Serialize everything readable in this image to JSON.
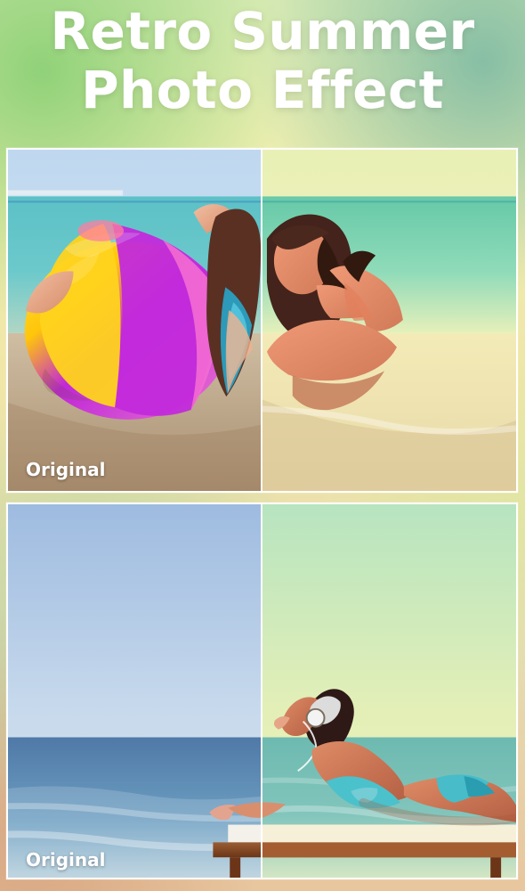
{
  "title": {
    "line1": "Retro Summer",
    "line2": "Photo Effect"
  },
  "top_panel": {
    "label": "Original"
  },
  "bottom_panel": {
    "label": "Original"
  }
}
